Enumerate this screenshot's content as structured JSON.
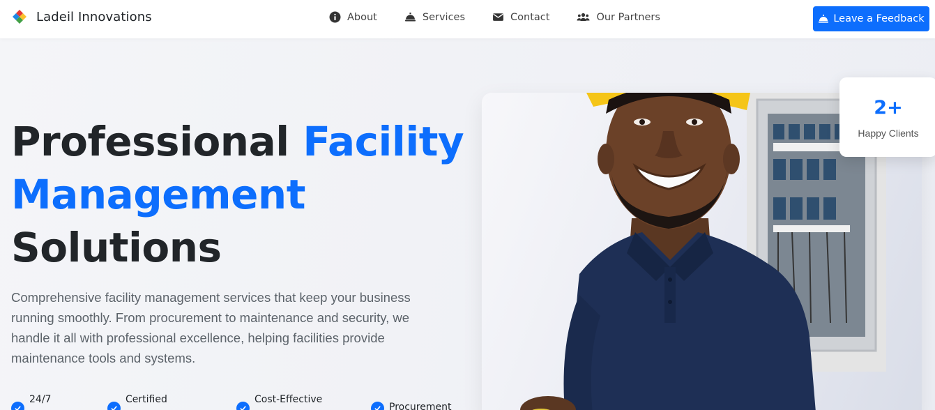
{
  "brand": {
    "name": "Ladeil Innovations",
    "logo_icon": "diamond-logo-icon"
  },
  "nav": {
    "items": [
      {
        "label": "About",
        "icon": "info-circle-icon"
      },
      {
        "label": "Services",
        "icon": "service-bell-icon"
      },
      {
        "label": "Contact",
        "icon": "envelope-icon"
      },
      {
        "label": "Our Partners",
        "icon": "users-icon"
      }
    ],
    "feedback_button": "Leave a Feedback",
    "feedback_icon": "service-bell-icon"
  },
  "hero": {
    "title_part1": "Professional ",
    "title_accent": "Facility Management",
    "title_part2": "Solutions",
    "description": "Comprehensive facility management services that keep your business running smoothly. From procurement to maintenance and security, we handle it all with professional excellence, helping facilities provide maintenance tools and systems.",
    "features": [
      "24/7",
      "Certified",
      "Cost-Effective",
      "Procurement"
    ]
  },
  "stats": {
    "value": "2+",
    "label": "Happy Clients"
  },
  "colors": {
    "accent": "#0d6efd",
    "text": "#212529",
    "muted": "#5c636a"
  }
}
